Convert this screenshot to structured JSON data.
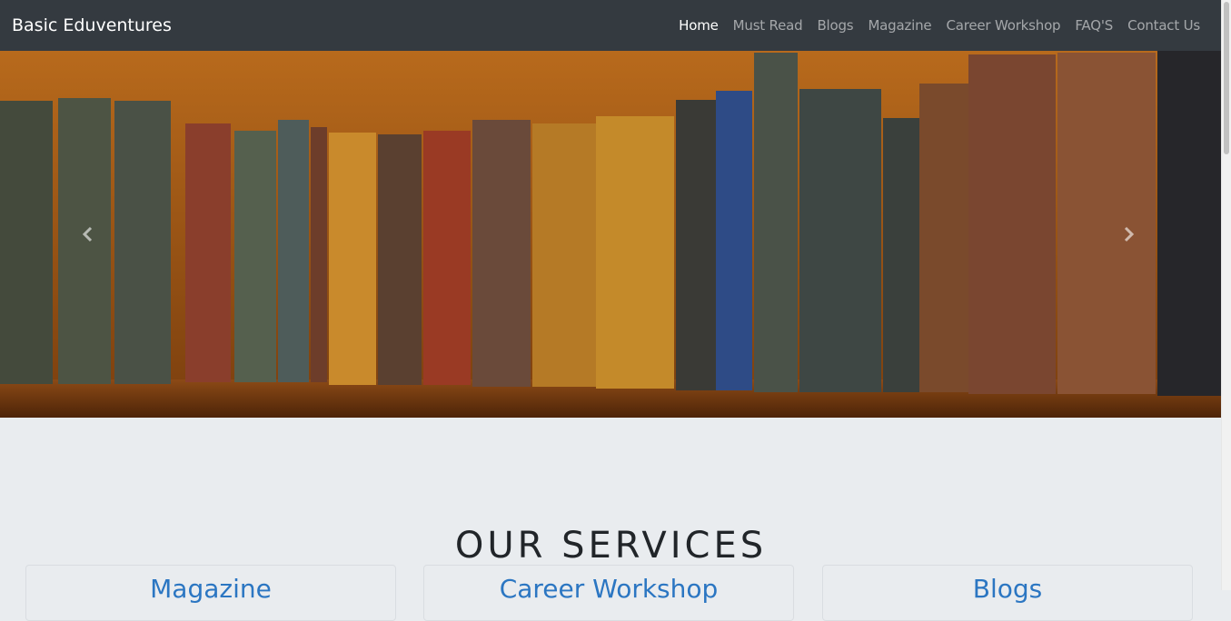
{
  "navbar": {
    "brand": "Basic Eduventures",
    "links": [
      {
        "label": "Home",
        "active": true
      },
      {
        "label": "Must Read",
        "active": false
      },
      {
        "label": "Blogs",
        "active": false
      },
      {
        "label": "Magazine",
        "active": false
      },
      {
        "label": "Career Workshop",
        "active": false
      },
      {
        "label": "FAQ'S",
        "active": false
      },
      {
        "label": "Contact Us",
        "active": false
      }
    ]
  },
  "carousel": {
    "prev_icon": "chevron-left-icon",
    "next_icon": "chevron-right-icon"
  },
  "services": {
    "title": "OUR SERVICES",
    "cards": [
      {
        "title": "Magazine"
      },
      {
        "title": "Career Workshop"
      },
      {
        "title": "Blogs"
      }
    ]
  },
  "colors": {
    "navbar_bg": "#343a40",
    "page_bg": "#e9ecef",
    "link_blue": "#2b76c2"
  }
}
